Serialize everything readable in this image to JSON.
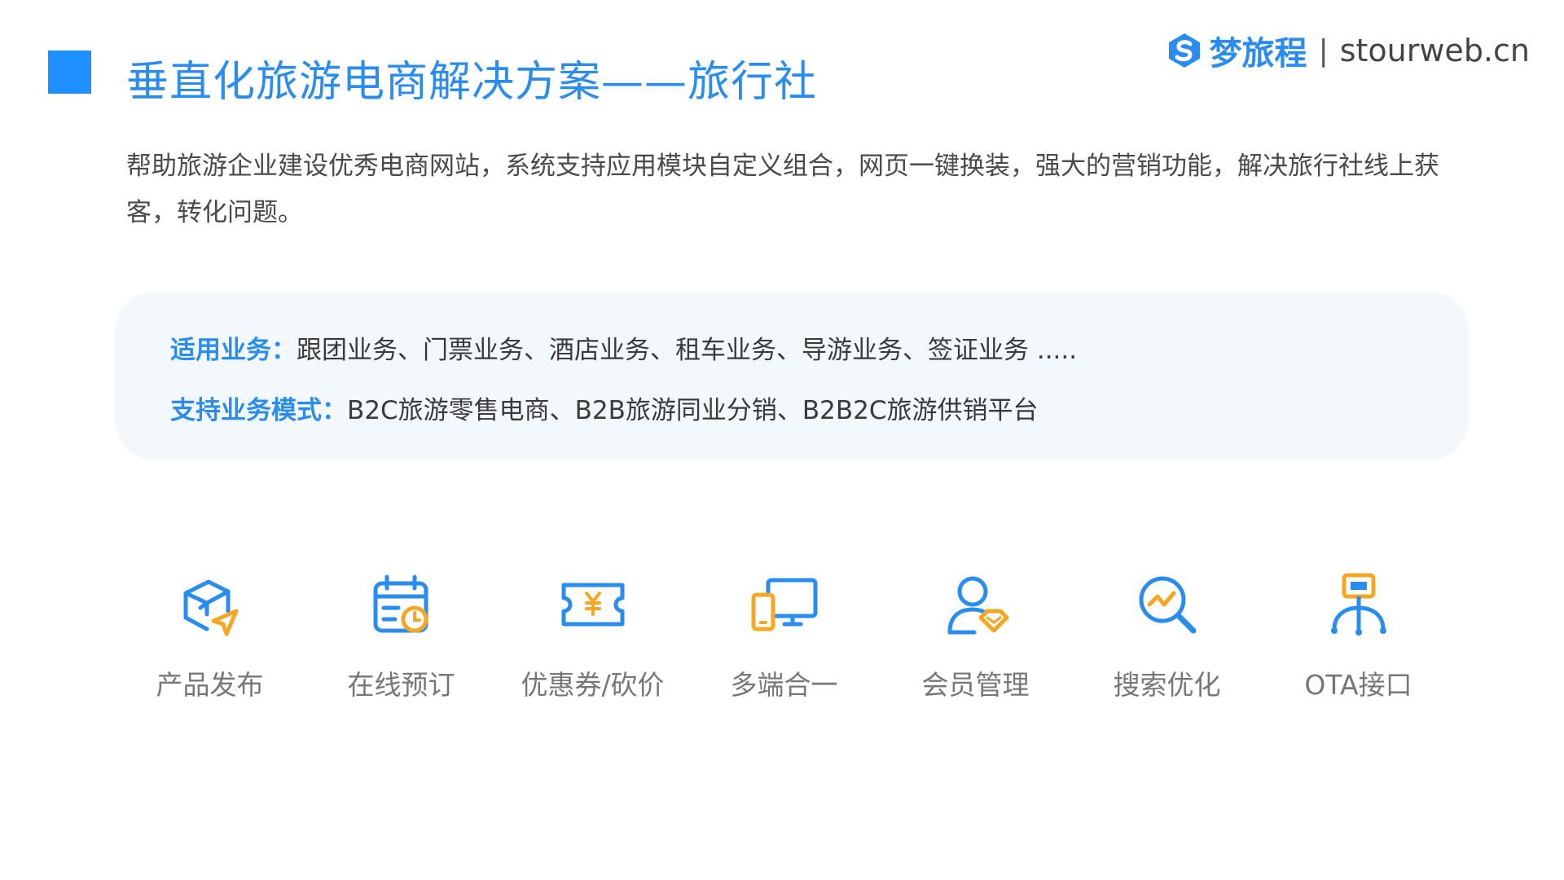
{
  "header": {
    "title": "垂直化旅游电商解决方案——旅行社",
    "logo_name": "梦旅程",
    "logo_separator": "|",
    "logo_domain": "stourweb.cn"
  },
  "intro": {
    "text": "帮助旅游企业建设优秀电商网站，系统支持应用模块自定义组合，网页一键换装，强大的营销功能，解决旅行社线上获客，转化问题。"
  },
  "info": {
    "business_label": "适用业务：",
    "business_value": "跟团业务、门票业务、酒店业务、租车业务、导游业务、签证业务 .....",
    "mode_label": "支持业务模式：",
    "mode_value": "B2C旅游零售电商、B2B旅游同业分销、B2B2C旅游供销平台"
  },
  "colors": {
    "brand_blue": "#2b8cf0",
    "accent_orange": "#f5a623",
    "card_bg": "#f3f8fd"
  },
  "features": [
    {
      "icon": "product-publish-icon",
      "label": "产品发布"
    },
    {
      "icon": "online-booking-icon",
      "label": "在线预订"
    },
    {
      "icon": "coupon-icon",
      "label": "优惠券/砍价"
    },
    {
      "icon": "multi-device-icon",
      "label": "多端合一"
    },
    {
      "icon": "member-management-icon",
      "label": "会员管理"
    },
    {
      "icon": "search-optimization-icon",
      "label": "搜索优化"
    },
    {
      "icon": "ota-interface-icon",
      "label": "OTA接口"
    }
  ]
}
